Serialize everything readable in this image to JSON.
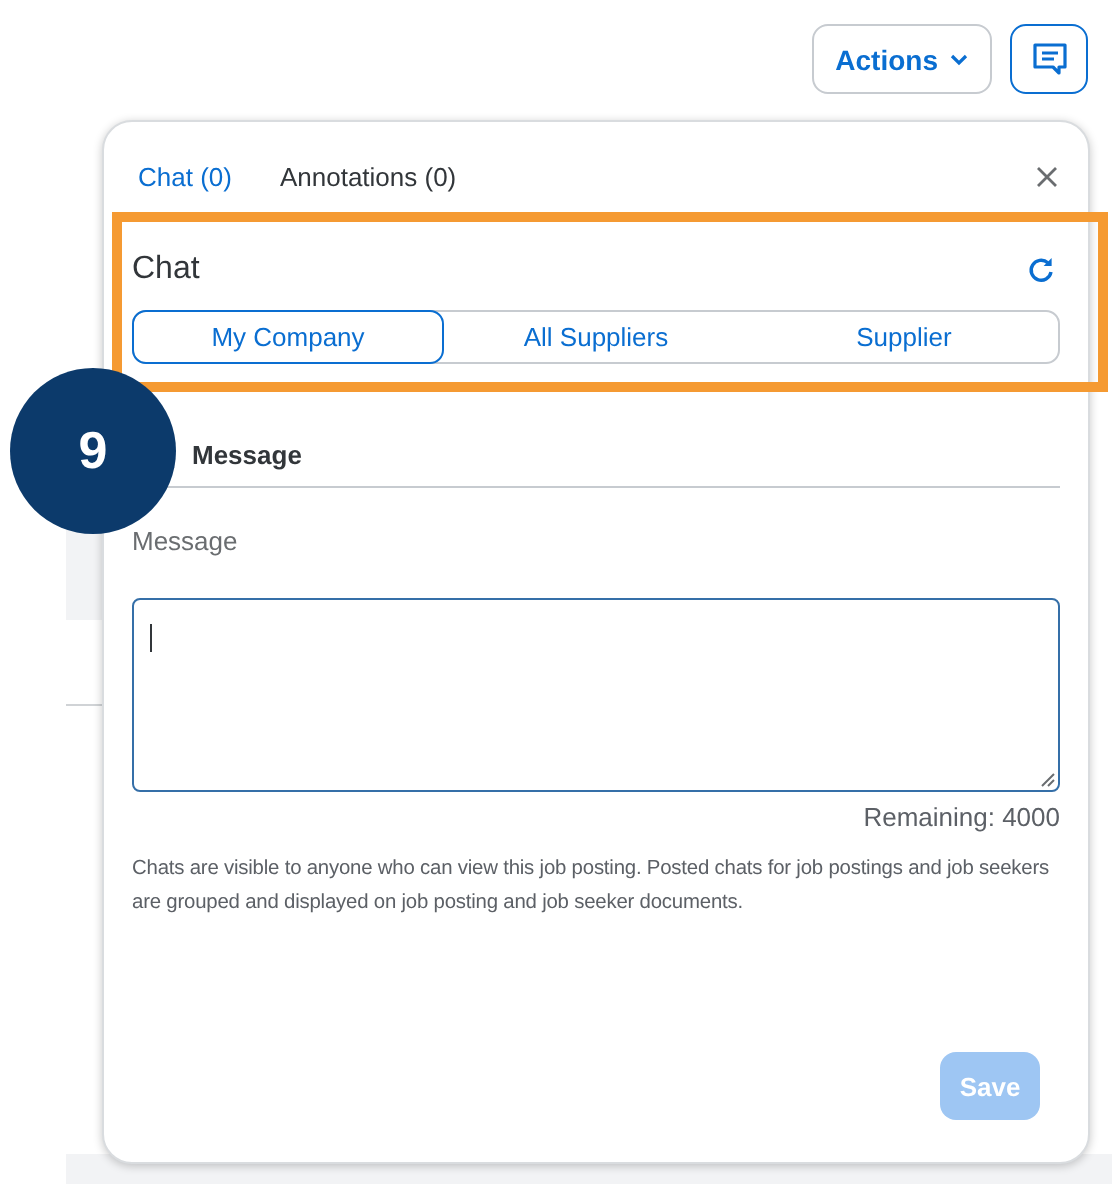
{
  "toolbar": {
    "actions_button": {
      "label": "Actions"
    },
    "chat_button": {
      "selected": true
    }
  },
  "popover": {
    "tabs": [
      {
        "label": "Chat (0)",
        "selected": true
      },
      {
        "label": "Annotations (0)",
        "selected": false
      }
    ],
    "chat": {
      "title": "Chat",
      "segments": [
        {
          "label": "My Company",
          "selected": true
        },
        {
          "label": "All Suppliers",
          "selected": false
        },
        {
          "label": "Supplier",
          "selected": false
        }
      ]
    },
    "add_message": {
      "heading": "Message",
      "field_label": "Message",
      "focused": true,
      "remaining": "Remaining: 4000",
      "note": "Chats are visible to anyone who can view this job posting. Posted chats for job postings and job seekers are grouped and displayed on job posting and job seeker documents."
    },
    "save_button": {
      "label": "Save",
      "disabled": true
    }
  },
  "callout": {
    "number": "9"
  }
}
